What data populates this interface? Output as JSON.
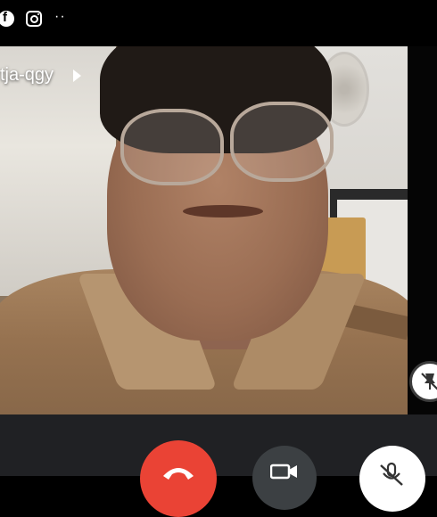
{
  "status_bar": {
    "icons": [
      "facebook-icon",
      "instagram-icon",
      "more-dots-icon"
    ],
    "dots": "··"
  },
  "meeting": {
    "code": "tja-qgy"
  },
  "controls": {
    "end_call_color": "#ea4335",
    "camera_color": "#3c4043",
    "mic_color": "#ffffff",
    "bar_color": "#202124"
  }
}
